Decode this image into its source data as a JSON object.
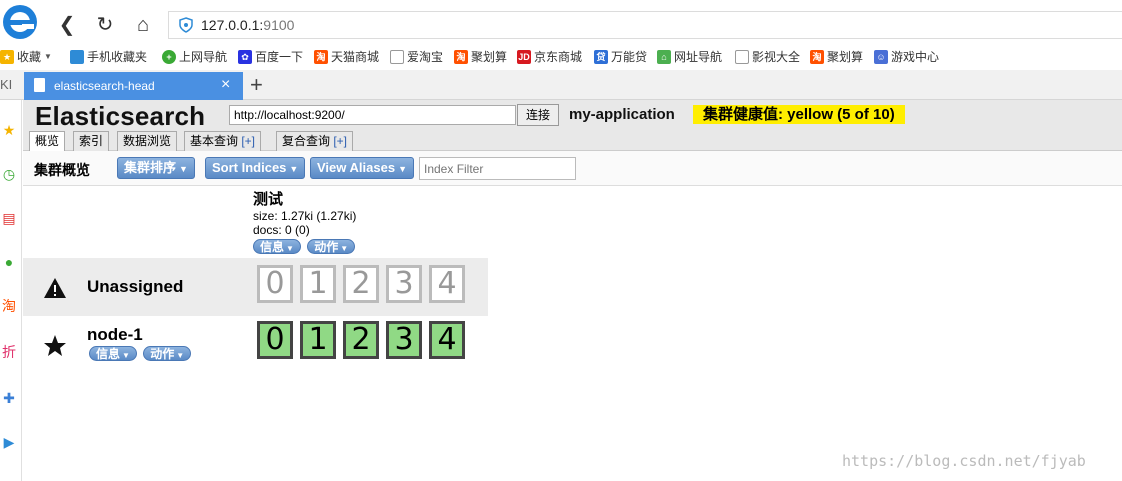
{
  "browser": {
    "title": "elasticsearch-head",
    "url_host": "127.0.0.1:",
    "url_port": "9100",
    "tab_title": "elasticsearch-head",
    "sidebar_label": "KI"
  },
  "bookmarks": [
    {
      "label": "收藏",
      "icon": "star-icon"
    },
    {
      "label": "手机收藏夹",
      "icon": "phone-icon"
    },
    {
      "label": "上网导航",
      "icon": "globe-icon"
    },
    {
      "label": "百度一下",
      "icon": "baidu-icon"
    },
    {
      "label": "天猫商城",
      "icon": "tao-icon"
    },
    {
      "label": "爱淘宝",
      "icon": "doc-icon"
    },
    {
      "label": "聚划算",
      "icon": "tao-icon"
    },
    {
      "label": "京东商城",
      "icon": "jd-icon"
    },
    {
      "label": "万能贷",
      "icon": "loan-icon"
    },
    {
      "label": "网址导航",
      "icon": "nav-icon"
    },
    {
      "label": "影视大全",
      "icon": "doc-icon"
    },
    {
      "label": "聚划算",
      "icon": "tao-icon"
    },
    {
      "label": "游戏中心",
      "icon": "game-icon"
    }
  ],
  "es": {
    "title": "Elasticsearch",
    "connection_url": "http://localhost:9200/",
    "connect_label": "连接",
    "cluster_name": "my-application",
    "health": "集群健康值: yellow (5 of 10)",
    "tabs": [
      {
        "label": "概览",
        "plus": ""
      },
      {
        "label": "索引",
        "plus": ""
      },
      {
        "label": "数据浏览",
        "plus": ""
      },
      {
        "label": "基本查询 ",
        "plus": "[+]"
      },
      {
        "label": "复合查询 ",
        "plus": "[+]"
      }
    ],
    "toolbar": {
      "title": "集群概览",
      "sort_cluster": "集群排序",
      "sort_indices": "Sort Indices",
      "view_aliases": "View Aliases",
      "filter_placeholder": "Index Filter"
    },
    "index": {
      "name": "测试",
      "size": "size: 1.27ki (1.27ki)",
      "docs": "docs: 0 (0)",
      "info_label": "信息",
      "action_label": "动作"
    },
    "rows": [
      {
        "name": "Unassigned",
        "icon": "warning-icon",
        "shards": [
          "0",
          "1",
          "2",
          "3",
          "4"
        ],
        "assigned": false
      },
      {
        "name": "node-1",
        "icon": "star-icon",
        "info_label": "信息",
        "action_label": "动作",
        "shards": [
          "0",
          "1",
          "2",
          "3",
          "4"
        ],
        "assigned": true
      }
    ]
  },
  "watermark": "https://blog.csdn.net/fjyab"
}
